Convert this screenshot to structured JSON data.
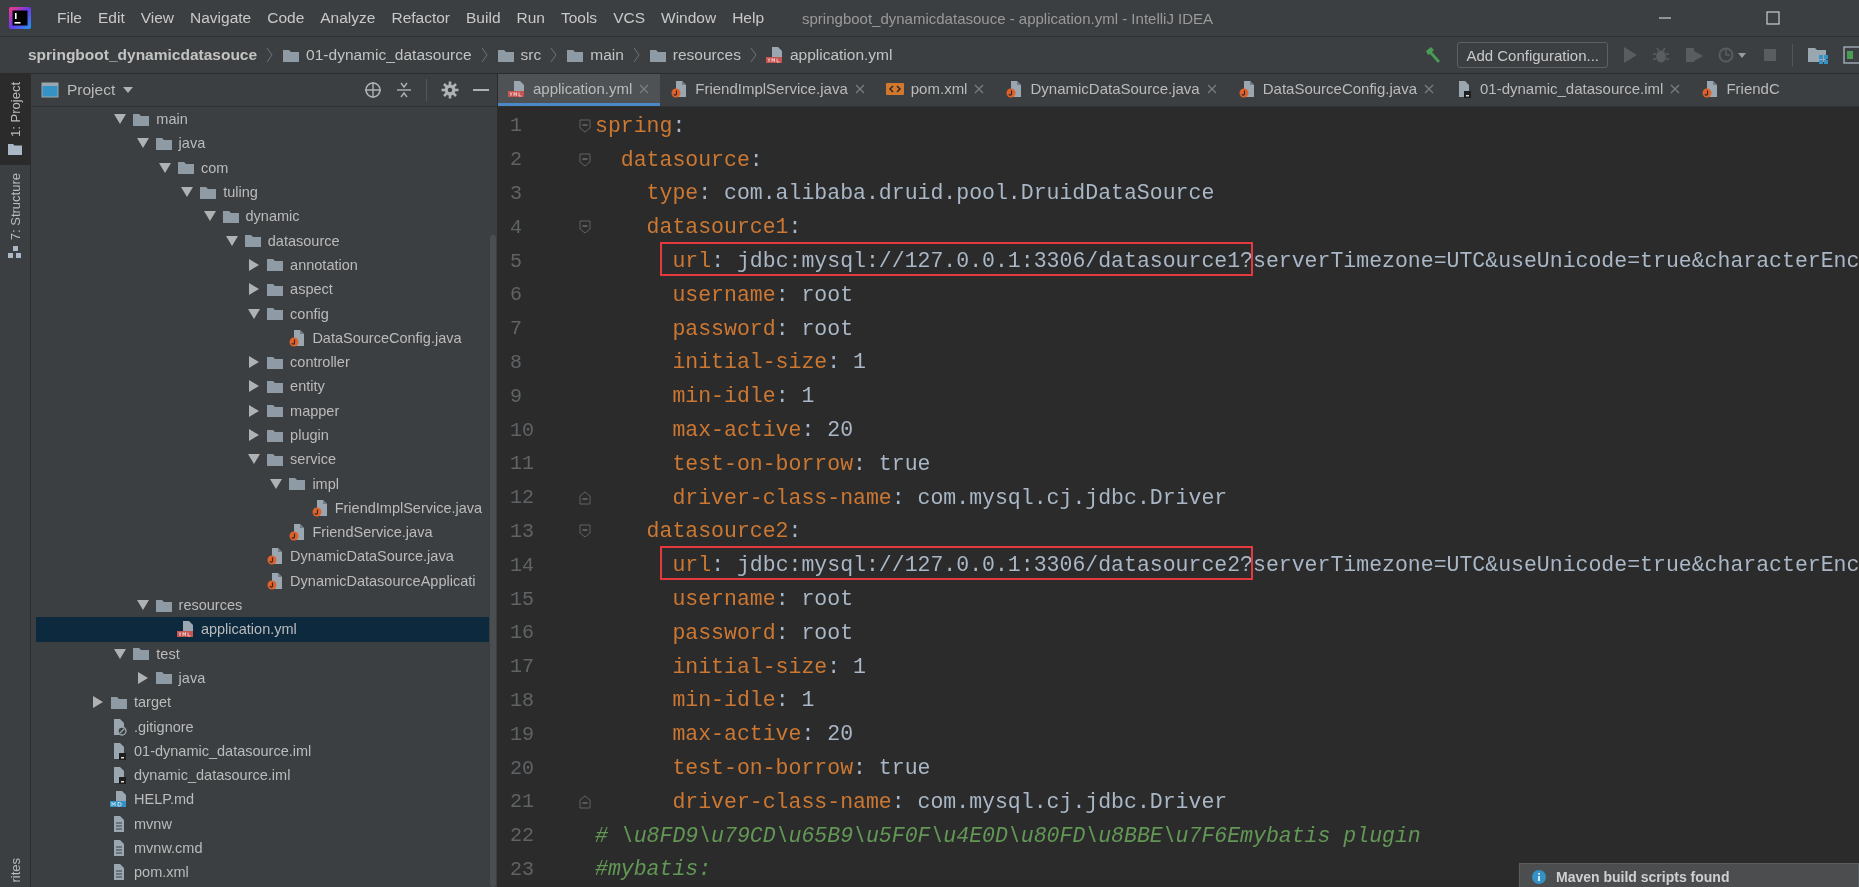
{
  "window": {
    "title": "springboot_dynamicdatasouce - application.yml - IntelliJ IDEA"
  },
  "menu": [
    "File",
    "Edit",
    "View",
    "Navigate",
    "Code",
    "Analyze",
    "Refactor",
    "Build",
    "Run",
    "Tools",
    "VCS",
    "Window",
    "Help"
  ],
  "breadcrumbs": [
    {
      "label": "springboot_dynamicdatasouce",
      "kind": "project"
    },
    {
      "label": "01-dynamic_datasource",
      "kind": "folder"
    },
    {
      "label": "src",
      "kind": "folder"
    },
    {
      "label": "main",
      "kind": "folder"
    },
    {
      "label": "resources",
      "kind": "folder"
    },
    {
      "label": "application.yml",
      "kind": "yml"
    }
  ],
  "toolbar": {
    "config_button": "Add Configuration..."
  },
  "tool_stripe": {
    "items": [
      {
        "label": "1: Project",
        "selected": true
      },
      {
        "label": "7: Structure",
        "selected": false
      }
    ],
    "bottom_label": "rites"
  },
  "project": {
    "title": "Project",
    "tree": [
      {
        "children": [
          {
            "name": "main",
            "kind": "folder",
            "expanded": true,
            "selected": false,
            "children": [
              {
                "name": "java",
                "kind": "folder",
                "expanded": true,
                "selected": false,
                "children": [
                  {
                    "name": "com",
                    "kind": "folder",
                    "expanded": true,
                    "selected": false,
                    "children": [
                      {
                        "name": "tuling",
                        "kind": "folder",
                        "expanded": true,
                        "selected": false,
                        "children": [
                          {
                            "name": "dynamic",
                            "kind": "folder",
                            "expanded": true,
                            "selected": false,
                            "children": [
                              {
                                "name": "datasource",
                                "kind": "folder",
                                "expanded": true,
                                "selected": false,
                                "children": [
                                  {
                                    "name": "annotation",
                                    "kind": "folder",
                                    "expanded": false,
                                    "selected": false
                                  },
                                  {
                                    "name": "aspect",
                                    "kind": "folder",
                                    "expanded": false,
                                    "selected": false
                                  },
                                  {
                                    "name": "config",
                                    "kind": "folder",
                                    "expanded": true,
                                    "selected": false,
                                    "children": [
                                      {
                                        "name": "DataSourceConfig.java",
                                        "kind": "java",
                                        "selected": false
                                      }
                                    ]
                                  },
                                  {
                                    "name": "controller",
                                    "kind": "folder",
                                    "expanded": false,
                                    "selected": false
                                  },
                                  {
                                    "name": "entity",
                                    "kind": "folder",
                                    "expanded": false,
                                    "selected": false
                                  },
                                  {
                                    "name": "mapper",
                                    "kind": "folder",
                                    "expanded": false,
                                    "selected": false
                                  },
                                  {
                                    "name": "plugin",
                                    "kind": "folder",
                                    "expanded": false,
                                    "selected": false
                                  },
                                  {
                                    "name": "service",
                                    "kind": "folder",
                                    "expanded": true,
                                    "selected": false,
                                    "children": [
                                      {
                                        "name": "impl",
                                        "kind": "folder",
                                        "expanded": true,
                                        "selected": false,
                                        "children": [
                                          {
                                            "name": "FriendImplService.java",
                                            "kind": "java",
                                            "selected": false
                                          }
                                        ]
                                      },
                                      {
                                        "name": "FriendService.java",
                                        "kind": "java",
                                        "selected": false
                                      }
                                    ]
                                  },
                                  {
                                    "name": "DynamicDataSource.java",
                                    "kind": "java",
                                    "selected": false
                                  },
                                  {
                                    "name": "DynamicDatasourceApplicati",
                                    "kind": "java",
                                    "selected": false
                                  }
                                ]
                              }
                            ]
                          }
                        ]
                      }
                    ]
                  }
                ]
              },
              {
                "name": "resources",
                "kind": "folder",
                "expanded": true,
                "selected": false,
                "children": [
                  {
                    "name": "application.yml",
                    "kind": "yml",
                    "selected": true
                  }
                ]
              }
            ]
          },
          {
            "name": "test",
            "kind": "folder",
            "expanded": true,
            "selected": false,
            "children": [
              {
                "name": "java",
                "kind": "folder",
                "expanded": false,
                "selected": false
              }
            ]
          }
        ]
      },
      {
        "name": "target",
        "kind": "folder",
        "expanded": false,
        "selected": false
      },
      {
        "name": ".gitignore",
        "kind": "git",
        "selected": false
      },
      {
        "name": "01-dynamic_datasource.iml",
        "kind": "iml",
        "selected": false
      },
      {
        "name": "dynamic_datasource.iml",
        "kind": "iml",
        "selected": false
      },
      {
        "name": "HELP.md",
        "kind": "md",
        "selected": false
      },
      {
        "name": "mvnw",
        "kind": "text",
        "selected": false
      },
      {
        "name": "mvnw.cmd",
        "kind": "text",
        "selected": false
      },
      {
        "name": "pom.xml",
        "kind": "text",
        "selected": false
      }
    ]
  },
  "tabs": [
    {
      "label": "application.yml",
      "kind": "yml",
      "selected": true,
      "closable": true
    },
    {
      "label": "FriendImplService.java",
      "kind": "java",
      "selected": false,
      "closable": true
    },
    {
      "label": "pom.xml",
      "kind": "xml",
      "selected": false,
      "closable": true
    },
    {
      "label": "DynamicDataSource.java",
      "kind": "java",
      "selected": false,
      "closable": true
    },
    {
      "label": "DataSourceConfig.java",
      "kind": "java",
      "selected": false,
      "closable": true
    },
    {
      "label": "01-dynamic_datasource.iml",
      "kind": "iml",
      "selected": false,
      "closable": true
    },
    {
      "label": "FriendC",
      "kind": "java",
      "selected": false,
      "closable": false
    }
  ],
  "code": {
    "lines": [
      {
        "number": "1",
        "kind": "pair",
        "key": "spring",
        "value": ":",
        "fold_open": true,
        "boxed": false,
        "children": [
          {
            "number": "2",
            "kind": "pair",
            "key": "datasource",
            "value": ":",
            "fold_open": true,
            "boxed": false,
            "children": [
              {
                "number": "3",
                "kind": "pair",
                "key": "type",
                "value": ": com.alibaba.druid.pool.DruidDataSource",
                "boxed": false
              },
              {
                "number": "4",
                "kind": "pair",
                "key": "datasource1",
                "value": ":",
                "fold_open": true,
                "boxed": false,
                "children": [
                  {
                    "number": "5",
                    "kind": "pair",
                    "key": "url",
                    "value": ": jdbc:mysql://127.0.0.1:3306/datasource1?serverTimezone=UTC&useUnicode=true&characterEnc",
                    "boxed": true
                  },
                  {
                    "number": "6",
                    "kind": "pair",
                    "key": "username",
                    "value": ": root",
                    "boxed": false
                  },
                  {
                    "number": "7",
                    "kind": "pair",
                    "key": "password",
                    "value": ": root",
                    "boxed": false
                  },
                  {
                    "number": "8",
                    "kind": "pair",
                    "key": "initial-size",
                    "value": ": 1",
                    "boxed": false
                  },
                  {
                    "number": "9",
                    "kind": "pair",
                    "key": "min-idle",
                    "value": ": 1",
                    "boxed": false
                  },
                  {
                    "number": "10",
                    "kind": "pair",
                    "key": "max-active",
                    "value": ": 20",
                    "boxed": false
                  },
                  {
                    "number": "11",
                    "kind": "pair",
                    "key": "test-on-borrow",
                    "value": ": true",
                    "boxed": false
                  },
                  {
                    "number": "12",
                    "kind": "pair",
                    "key": "driver-class-name",
                    "value": ": com.mysql.cj.jdbc.Driver",
                    "fold_open": false,
                    "boxed": false
                  }
                ]
              },
              {
                "number": "13",
                "kind": "pair",
                "key": "datasource2",
                "value": ":",
                "fold_open": true,
                "boxed": false,
                "children": [
                  {
                    "number": "14",
                    "kind": "pair",
                    "key": "url",
                    "value": ": jdbc:mysql://127.0.0.1:3306/datasource2?serverTimezone=UTC&useUnicode=true&characterEnc",
                    "boxed": true
                  },
                  {
                    "number": "15",
                    "kind": "pair",
                    "key": "username",
                    "value": ": root",
                    "boxed": false
                  },
                  {
                    "number": "16",
                    "kind": "pair",
                    "key": "password",
                    "value": ": root",
                    "boxed": false
                  },
                  {
                    "number": "17",
                    "kind": "pair",
                    "key": "initial-size",
                    "value": ": 1",
                    "boxed": false
                  },
                  {
                    "number": "18",
                    "kind": "pair",
                    "key": "min-idle",
                    "value": ": 1",
                    "boxed": false
                  },
                  {
                    "number": "19",
                    "kind": "pair",
                    "key": "max-active",
                    "value": ": 20",
                    "boxed": false
                  },
                  {
                    "number": "20",
                    "kind": "pair",
                    "key": "test-on-borrow",
                    "value": ": true",
                    "boxed": false
                  },
                  {
                    "number": "21",
                    "kind": "pair",
                    "key": "driver-class-name",
                    "value": ": com.mysql.cj.jdbc.Driver",
                    "fold_open": false,
                    "boxed": false
                  }
                ]
              }
            ]
          }
        ]
      },
      {
        "number": "22",
        "kind": "comment",
        "text": "# \\u8FD9\\u79CD\\u65B9\\u5F0F\\u4E0D\\u80FD\\u8BBE\\u7F6Emybatis plugin",
        "boxed": false
      },
      {
        "number": "23",
        "kind": "comment",
        "text": "#mybatis:",
        "boxed": false
      }
    ]
  },
  "notification": {
    "text": "Maven build scripts found"
  }
}
